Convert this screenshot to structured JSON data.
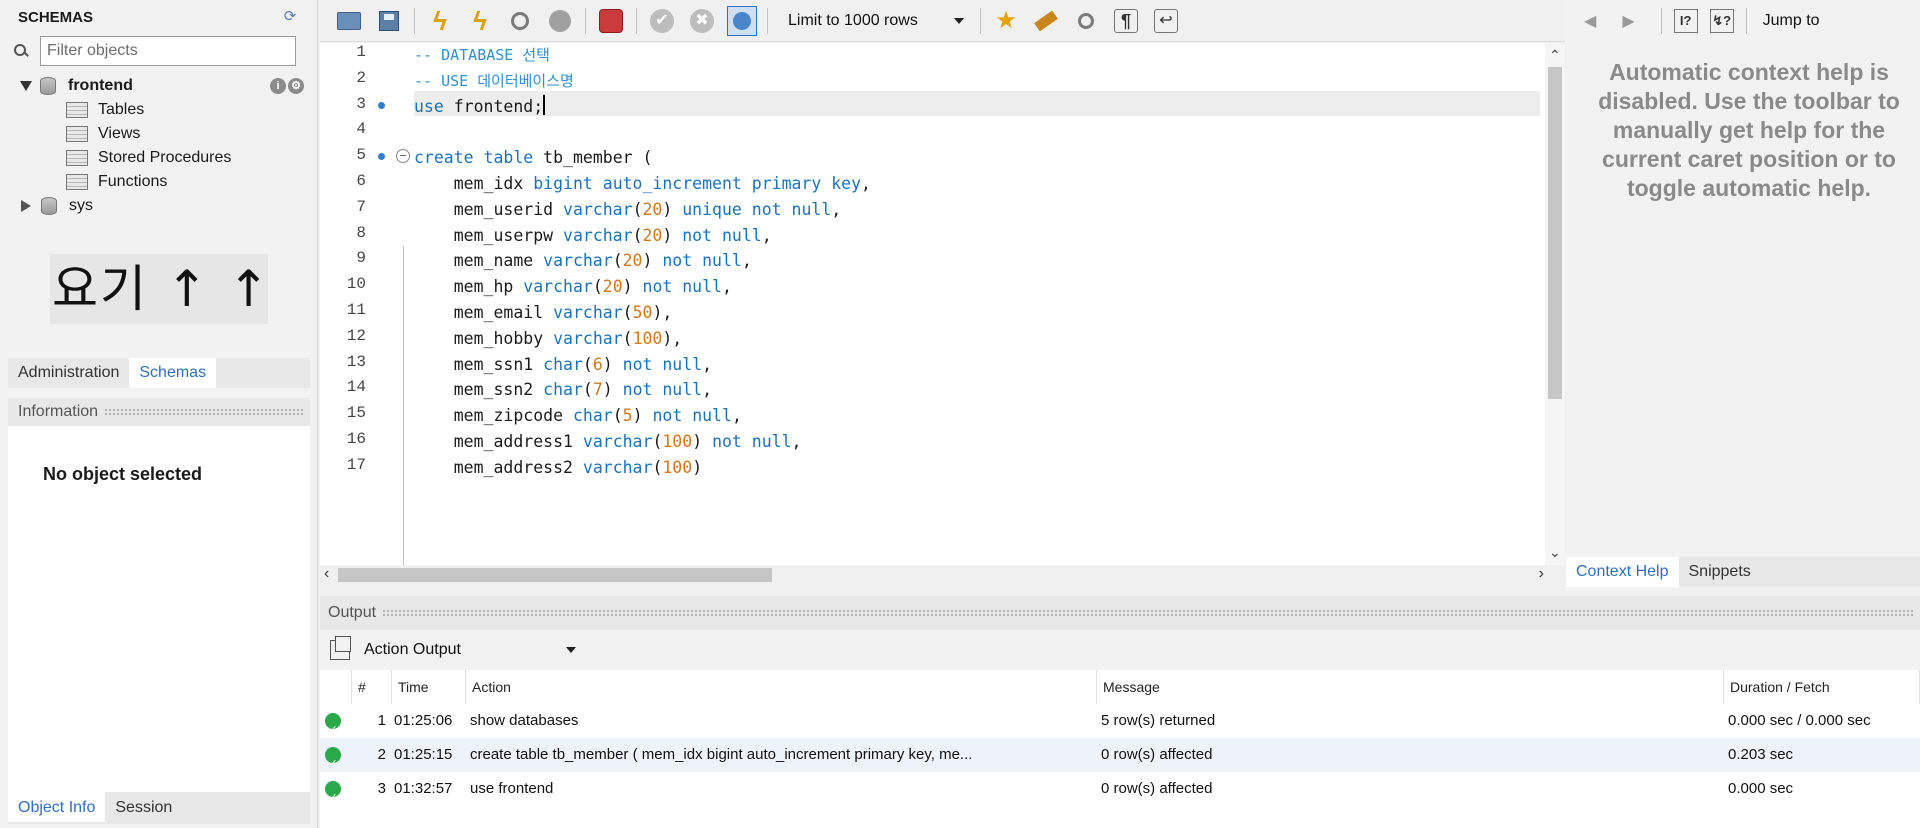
{
  "sidebar": {
    "title": "SCHEMAS",
    "filter_placeholder": "Filter objects",
    "schemas": [
      {
        "name": "frontend",
        "expanded": true,
        "children": [
          "Tables",
          "Views",
          "Stored Procedures",
          "Functions"
        ]
      },
      {
        "name": "sys",
        "expanded": false
      }
    ],
    "overlay_text": "요기 ↑ ↑",
    "tabs": [
      "Administration",
      "Schemas"
    ],
    "active_tab": "Schemas",
    "information_label": "Information",
    "no_object_text": "No object selected",
    "bottom_tabs": [
      "Object Info",
      "Session"
    ]
  },
  "toolbar": {
    "limit_label": "Limit to 1000 rows",
    "icons": [
      "open-folder-icon",
      "save-icon",
      "execute-icon",
      "execute-current-icon",
      "explain-icon",
      "stop-icon",
      "toggle-error-icon",
      "commit-icon",
      "rollback-icon",
      "autocommit-icon",
      "bookmark-icon",
      "beautify-icon",
      "find-icon",
      "invisible-chars-icon",
      "wrap-icon"
    ]
  },
  "editor": {
    "lines": [
      {
        "n": "1",
        "marker": false,
        "fold": false,
        "html_key": "l1"
      },
      {
        "n": "2"
      },
      {
        "n": "3",
        "marker": true
      },
      {
        "n": "4"
      },
      {
        "n": "5",
        "marker": true,
        "fold": true
      },
      {
        "n": "6"
      },
      {
        "n": "7"
      },
      {
        "n": "8"
      },
      {
        "n": "9"
      },
      {
        "n": "10"
      },
      {
        "n": "11"
      },
      {
        "n": "12"
      },
      {
        "n": "13"
      },
      {
        "n": "14"
      },
      {
        "n": "15"
      },
      {
        "n": "16"
      },
      {
        "n": "17"
      }
    ],
    "code": [
      [
        [
          "com",
          "-- DATABASE 선택"
        ]
      ],
      [
        [
          "com",
          "-- USE 데이터베이스명"
        ]
      ],
      [
        [
          "kw",
          "use"
        ],
        [
          "",
          " frontend;"
        ]
      ],
      [],
      [
        [
          "kw",
          "create table"
        ],
        [
          "",
          " tb_member ("
        ]
      ],
      [
        [
          "",
          "    mem_idx "
        ],
        [
          "kw",
          "bigint auto_increment primary key"
        ],
        [
          "",
          ","
        ]
      ],
      [
        [
          "",
          "    mem_userid "
        ],
        [
          "kw",
          "varchar"
        ],
        [
          "",
          "("
        ],
        [
          "num",
          "20"
        ],
        [
          "",
          ") "
        ],
        [
          "kw",
          "unique not null"
        ],
        [
          "",
          ","
        ]
      ],
      [
        [
          "",
          "    mem_userpw "
        ],
        [
          "kw",
          "varchar"
        ],
        [
          "",
          "("
        ],
        [
          "num",
          "20"
        ],
        [
          "",
          ") "
        ],
        [
          "kw",
          "not null"
        ],
        [
          "",
          ","
        ]
      ],
      [
        [
          "",
          "    mem_name "
        ],
        [
          "kw",
          "varchar"
        ],
        [
          "",
          "("
        ],
        [
          "num",
          "20"
        ],
        [
          "",
          ") "
        ],
        [
          "kw",
          "not null"
        ],
        [
          "",
          ","
        ]
      ],
      [
        [
          "",
          "    mem_hp "
        ],
        [
          "kw",
          "varchar"
        ],
        [
          "",
          "("
        ],
        [
          "num",
          "20"
        ],
        [
          "",
          ") "
        ],
        [
          "kw",
          "not null"
        ],
        [
          "",
          ","
        ]
      ],
      [
        [
          "",
          "    mem_email "
        ],
        [
          "kw",
          "varchar"
        ],
        [
          "",
          "("
        ],
        [
          "num",
          "50"
        ],
        [
          "",
          "),"
        ]
      ],
      [
        [
          "",
          "    mem_hobby "
        ],
        [
          "kw",
          "varchar"
        ],
        [
          "",
          "("
        ],
        [
          "num",
          "100"
        ],
        [
          "",
          "),"
        ]
      ],
      [
        [
          "",
          "    mem_ssn1 "
        ],
        [
          "kw",
          "char"
        ],
        [
          "",
          "("
        ],
        [
          "num",
          "6"
        ],
        [
          "",
          ") "
        ],
        [
          "kw",
          "not null"
        ],
        [
          "",
          ","
        ]
      ],
      [
        [
          "",
          "    mem_ssn2 "
        ],
        [
          "kw",
          "char"
        ],
        [
          "",
          "("
        ],
        [
          "num",
          "7"
        ],
        [
          "",
          ") "
        ],
        [
          "kw",
          "not null"
        ],
        [
          "",
          ","
        ]
      ],
      [
        [
          "",
          "    mem_zipcode "
        ],
        [
          "kw",
          "char"
        ],
        [
          "",
          "("
        ],
        [
          "num",
          "5"
        ],
        [
          "",
          ") "
        ],
        [
          "kw",
          "not null"
        ],
        [
          "",
          ","
        ]
      ],
      [
        [
          "",
          "    mem_address1 "
        ],
        [
          "kw",
          "varchar"
        ],
        [
          "",
          "("
        ],
        [
          "num",
          "100"
        ],
        [
          "",
          ") "
        ],
        [
          "kw",
          "not null"
        ],
        [
          "",
          ","
        ]
      ],
      [
        [
          "",
          "    mem_address2 "
        ],
        [
          "kw",
          "varchar"
        ],
        [
          "",
          "("
        ],
        [
          "num",
          "100"
        ],
        [
          "",
          ")"
        ]
      ]
    ]
  },
  "context_help": {
    "jump_to_label": "Jump to",
    "help_text_lines": [
      "Automatic context help is",
      "disabled. Use the toolbar to",
      "manually get help for the",
      "current caret position or to",
      "toggle automatic help."
    ],
    "tabs": [
      "Context Help",
      "Snippets"
    ],
    "active_tab": "Context Help"
  },
  "output": {
    "title": "Output",
    "selector": "Action Output",
    "columns": [
      "#",
      "Time",
      "Action",
      "Message",
      "Duration / Fetch"
    ],
    "rows": [
      {
        "num": "1",
        "time": "01:25:06",
        "action": "show databases",
        "message": "5 row(s) returned",
        "duration": "0.000 sec / 0.000 sec"
      },
      {
        "num": "2",
        "time": "01:25:15",
        "action": "create table tb_member (            mem_idx bigint auto_increment primary key,        me...",
        "message": "0 row(s) affected",
        "duration": "0.203 sec"
      },
      {
        "num": "3",
        "time": "01:32:57",
        "action": "use frontend",
        "message": "0 row(s) affected",
        "duration": "0.000 sec"
      }
    ]
  },
  "colors": {
    "keyword": "#1a73b8",
    "number": "#d1791a",
    "comment": "#2f8fd0",
    "accent": "#2f6fbe",
    "success": "#2aa84a"
  }
}
